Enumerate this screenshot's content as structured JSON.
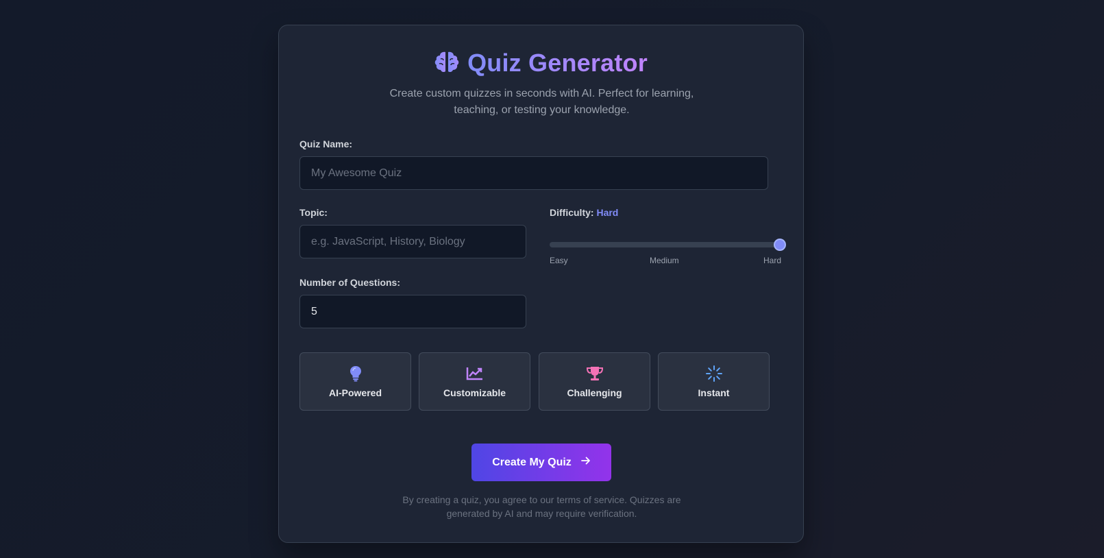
{
  "header": {
    "title": "Quiz Generator",
    "icon": "brain-icon",
    "subtitle": "Create custom quizzes in seconds with AI. Perfect for learning, teaching, or testing your knowledge."
  },
  "form": {
    "quiz_name": {
      "label": "Quiz Name:",
      "placeholder": "My Awesome Quiz",
      "value": ""
    },
    "topic": {
      "label": "Topic:",
      "placeholder": "e.g. JavaScript, History, Biology",
      "value": ""
    },
    "difficulty": {
      "label": "Difficulty:",
      "value_label": "Hard",
      "options": [
        "Easy",
        "Medium",
        "Hard"
      ],
      "selected_index": 2
    },
    "num_questions": {
      "label": "Number of Questions:",
      "value": "5"
    }
  },
  "features": [
    {
      "label": "AI-Powered",
      "icon": "lightbulb-icon",
      "color": "#818cf8"
    },
    {
      "label": "Customizable",
      "icon": "chart-line-icon",
      "color": "#c084fc"
    },
    {
      "label": "Challenging",
      "icon": "trophy-icon",
      "color": "#f472b6"
    },
    {
      "label": "Instant",
      "icon": "spinner-icon",
      "color": "#60a5fa"
    }
  ],
  "cta": {
    "label": "Create My Quiz",
    "icon": "arrow-right-icon"
  },
  "footer": {
    "text": "By creating a quiz, you agree to our terms of service. Quizzes are generated by AI and may require verification."
  },
  "colors": {
    "accent": "#818cf8",
    "accent_purple": "#c084fc",
    "background": "#131a2a",
    "card": "#1e2535"
  }
}
